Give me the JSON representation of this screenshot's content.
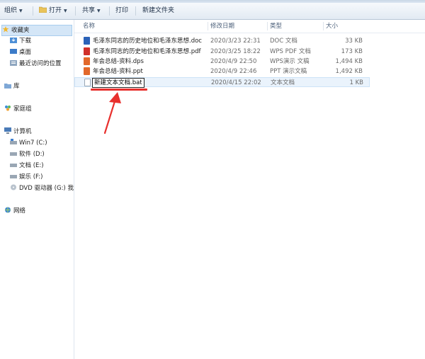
{
  "toolbar": {
    "organize": "组织",
    "open": "打开",
    "share": "共享",
    "print": "打印",
    "new_folder": "新建文件夹"
  },
  "nav": {
    "favorites": "收藏夹",
    "downloads": "下载",
    "desktop": "桌面",
    "recent": "最近访问的位置",
    "libraries": "库",
    "homegroup": "家庭组",
    "computer": "计算机",
    "drive_c": "Win7 (C:)",
    "drive_d": "软件 (D:)",
    "drive_e": "文档 (E:)",
    "drive_f": "娱乐 (F:)",
    "drive_g": "DVD 驱动器 (G:) 我",
    "network": "网络"
  },
  "columns": {
    "name": "名称",
    "date": "修改日期",
    "type": "类型",
    "size": "大小"
  },
  "files": [
    {
      "name": "毛泽东同志的历史地位和毛泽东思想.doc",
      "date": "2020/3/23 22:31",
      "type": "DOC 文档",
      "size": "33 KB",
      "icon_color": "#2b62b8"
    },
    {
      "name": "毛泽东同志的历史地位和毛泽东思想.pdf",
      "date": "2020/3/25 18:22",
      "type": "WPS PDF 文档",
      "size": "173 KB",
      "icon_color": "#d0302a"
    },
    {
      "name": "年会总结-资料.dps",
      "date": "2020/4/9 22:50",
      "type": "WPS演示 文稿",
      "size": "1,494 KB",
      "icon_color": "#e2682a"
    },
    {
      "name": "年会总结-资料.ppt",
      "date": "2020/4/9 22:46",
      "type": "PPT 演示文稿",
      "size": "1,492 KB",
      "icon_color": "#e2682a"
    },
    {
      "name": "新建文本文档.bat",
      "date": "2020/4/15 22:02",
      "type": "文本文档",
      "size": "1 KB",
      "icon_color": "#ffffff"
    }
  ],
  "accent_color": "#e8302d"
}
